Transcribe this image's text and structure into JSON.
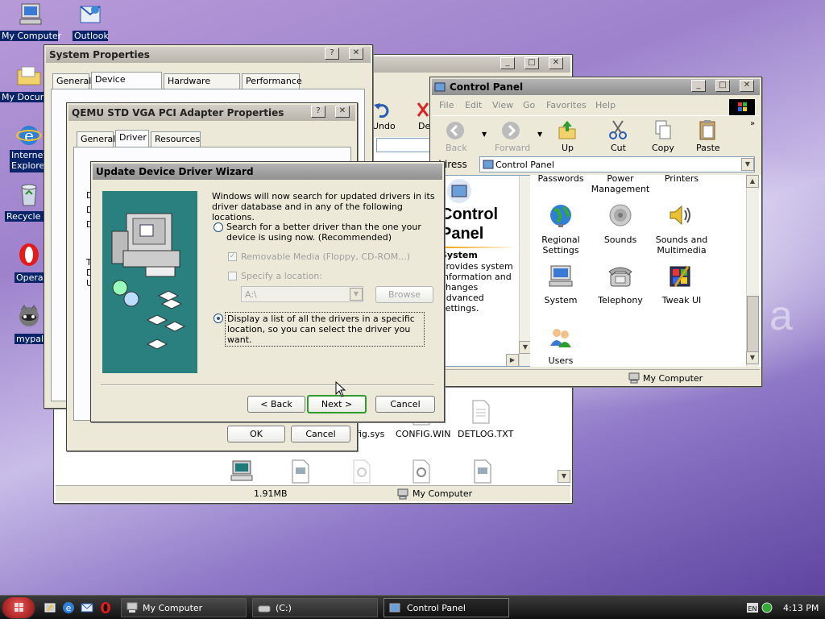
{
  "desktop": {
    "icons": [
      {
        "label": "My Computer",
        "icon": "computer-icon"
      },
      {
        "label": "Outlook",
        "icon": "outlook-icon"
      },
      {
        "label": "My Docume",
        "icon": "folder-icon"
      },
      {
        "label": "Internet Explorer",
        "icon": "ie-icon"
      },
      {
        "label": "Recycle B",
        "icon": "recycle-bin-icon"
      },
      {
        "label": "Opera",
        "icon": "opera-icon"
      },
      {
        "label": "mypal",
        "icon": "mypal-icon"
      }
    ]
  },
  "explorer_back": {
    "toolbar": {
      "undo": "Undo",
      "delete": "De"
    },
    "files": [
      "fig.sys",
      "CONFIG.WIN",
      "DETLOG.TXT"
    ],
    "status": {
      "size": "1.91MB",
      "location": "My Computer"
    }
  },
  "system_properties": {
    "title": "System Properties",
    "tabs": [
      "General",
      "Device Manager",
      "Hardware Profiles",
      "Performance"
    ]
  },
  "adapter_props": {
    "title": "QEMU STD VGA PCI Adapter Properties",
    "tabs": [
      "General",
      "Driver",
      "Resources"
    ],
    "side_letters": [
      "D",
      "D",
      "D",
      "T",
      "D",
      "U"
    ],
    "ok": "OK",
    "cancel": "Cancel"
  },
  "wizard": {
    "title": "Update Device Driver Wizard",
    "intro": "Windows will now search for updated drivers in its driver database and in any of the following locations.",
    "option1": "Search for a better driver than the one your device is using now. (Recommended)",
    "removable_media": "Removable Media (Floppy, CD-ROM...)",
    "specify_location": "Specify a location:",
    "location_value": "A:\\",
    "browse": "Browse",
    "option2": "Display a list of all the drivers in a specific location, so you can select the driver you want.",
    "back": "< Back",
    "next": "Next >",
    "cancel": "Cancel"
  },
  "control_panel": {
    "title": "Control Panel",
    "menu": [
      "File",
      "Edit",
      "View",
      "Go",
      "Favorites",
      "Help"
    ],
    "toolbar": [
      "Back",
      "Forward",
      "Up",
      "Cut",
      "Copy",
      "Paste"
    ],
    "address_label": "ddress",
    "address_value": "Control Panel",
    "heading": "Control Panel",
    "desc_title": "System",
    "desc_text": "Provides system information and changes advanced settings.",
    "items": [
      {
        "label": "Passwords",
        "icon": "passwords-icon"
      },
      {
        "label": "Power Management",
        "icon": "power-icon"
      },
      {
        "label": "Printers",
        "icon": "printers-icon"
      },
      {
        "label": "Regional Settings",
        "icon": "globe-icon"
      },
      {
        "label": "Sounds",
        "icon": "speaker-icon"
      },
      {
        "label": "Sounds and Multimedia",
        "icon": "multimedia-icon"
      },
      {
        "label": "System",
        "icon": "system-icon"
      },
      {
        "label": "Telephony",
        "icon": "telephone-icon"
      },
      {
        "label": "Tweak UI",
        "icon": "tweak-ui-icon"
      },
      {
        "label": "Users",
        "icon": "users-icon"
      }
    ],
    "status": "My Computer"
  },
  "taskbar": {
    "tasks": [
      "My Computer",
      "(C:)",
      "Control Panel"
    ],
    "clock": "4:13 PM"
  }
}
